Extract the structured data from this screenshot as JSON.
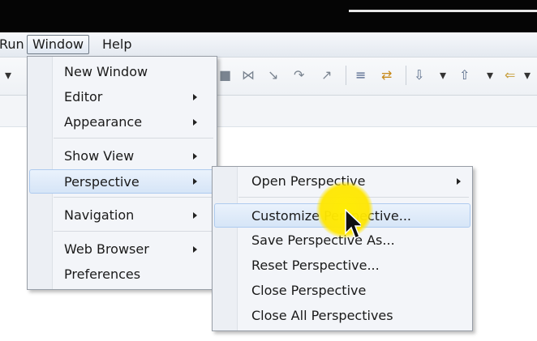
{
  "menubar": {
    "run_label": "Run",
    "window_label": "Window",
    "help_label": "Help"
  },
  "window_menu": {
    "items": [
      {
        "label": "New Window"
      },
      {
        "label": "Editor"
      },
      {
        "label": "Appearance"
      },
      {
        "label": "Show View"
      },
      {
        "label": "Perspective"
      },
      {
        "label": "Navigation"
      },
      {
        "label": "Web Browser"
      },
      {
        "label": "Preferences"
      }
    ]
  },
  "perspective_menu": {
    "items": [
      {
        "label": "Open Perspective"
      },
      {
        "label": "Customize Perspective..."
      },
      {
        "label": "Save Perspective As..."
      },
      {
        "label": "Reset Perspective..."
      },
      {
        "label": "Close Perspective"
      },
      {
        "label": "Close All Perspectives"
      }
    ]
  },
  "highlight_color": "#ffe600"
}
